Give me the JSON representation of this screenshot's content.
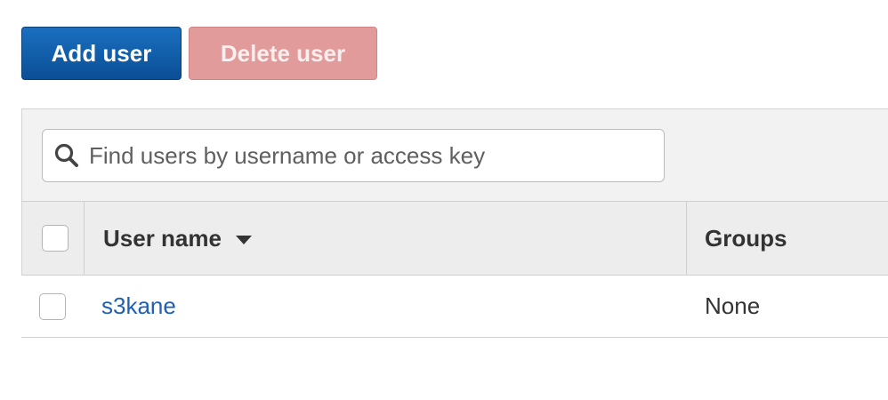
{
  "toolbar": {
    "add_user_label": "Add user",
    "delete_user_label": "Delete user"
  },
  "search": {
    "placeholder": "Find users by username or access key",
    "value": "",
    "icon": "search-icon"
  },
  "table": {
    "columns": [
      "User name",
      "Groups"
    ],
    "sort": {
      "column": "User name",
      "direction": "descending"
    },
    "rows": [
      {
        "user_name": "s3kane",
        "groups": "None",
        "selected": false
      }
    ]
  },
  "colors": {
    "primary_button": "#0b5aa8",
    "danger_button_disabled": "#e29b9b",
    "link": "#1f5fb5",
    "header_bg": "#ededed"
  }
}
